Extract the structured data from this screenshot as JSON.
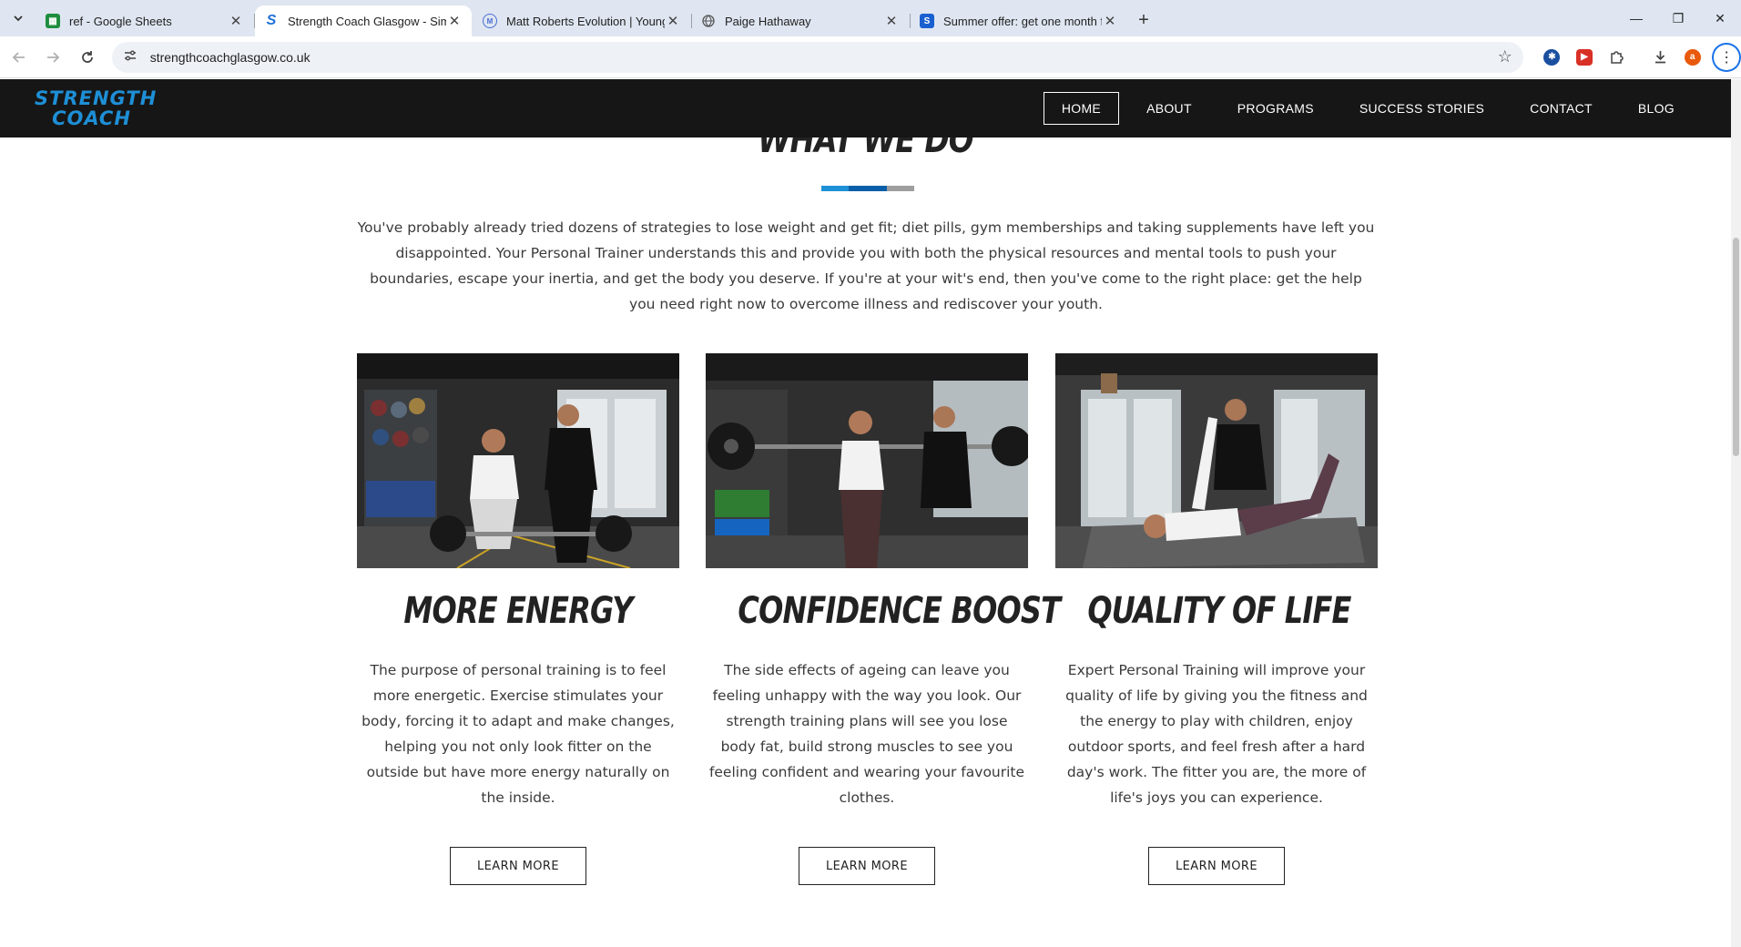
{
  "browser": {
    "tabs": [
      {
        "title": "ref - Google Sheets",
        "icon": "sheets-icon",
        "color": "#1e8e3e",
        "active": false
      },
      {
        "title": "Strength Coach Glasgow - Simp",
        "icon": "strength-coach-favicon",
        "color": "#1e6fd6",
        "active": true
      },
      {
        "title": "Matt Roberts Evolution | Young",
        "icon": "matt-roberts-favicon",
        "color": "#4a6cd4",
        "active": false
      },
      {
        "title": "Paige Hathaway",
        "icon": "globe-icon",
        "color": "#666666",
        "active": false
      },
      {
        "title": "Summer offer: get one month f",
        "icon": "offer-favicon",
        "color": "#1a5fd0",
        "active": false
      }
    ],
    "url": "strengthcoachglasgow.co.uk",
    "profile_initial": "a"
  },
  "site": {
    "logo": {
      "line1": "STRENGTH",
      "line2": "COACH"
    },
    "nav": [
      "HOME",
      "ABOUT",
      "PROGRAMS",
      "SUCCESS STORIES",
      "CONTACT",
      "BLOG"
    ],
    "active_nav": "HOME",
    "section_title": "WHAT WE DO",
    "intro": "You've probably already tried dozens of strategies to lose weight and get fit; diet pills, gym memberships and taking supplements have left you disappointed. Your Personal Trainer understands this and provide you with both the physical resources and mental tools to push your boundaries, escape your inertia, and get the body you deserve. If you're at your wit's end, then you've come to the right place: get the help you need right now to overcome illness and rediscover your youth.",
    "cards": [
      {
        "title": "MORE ENERGY",
        "text": "The purpose of personal training is to feel more energetic. Exercise stimulates your body, forcing it to adapt and make changes, helping you not only look fitter on the outside but have more energy naturally on the inside.",
        "button": "LEARN MORE"
      },
      {
        "title": "CONFIDENCE BOOST",
        "text": "The side effects of ageing can leave you feeling unhappy with the way you look. Our strength training plans will see you lose body fat, build strong muscles to see you feeling confident and wearing your favourite clothes.",
        "button": "LEARN MORE"
      },
      {
        "title": "QUALITY OF LIFE",
        "text": "Expert Personal Training will improve your quality of life by giving you the fitness and the energy to play with children, enjoy outdoor sports, and feel fresh after a hard day's work. The fitter you are, the more of life's joys you can experience.",
        "button": "LEARN MORE"
      }
    ],
    "accent_colors": [
      "#1e90d6",
      "#0b5fa8",
      "#9e9e9e"
    ]
  }
}
